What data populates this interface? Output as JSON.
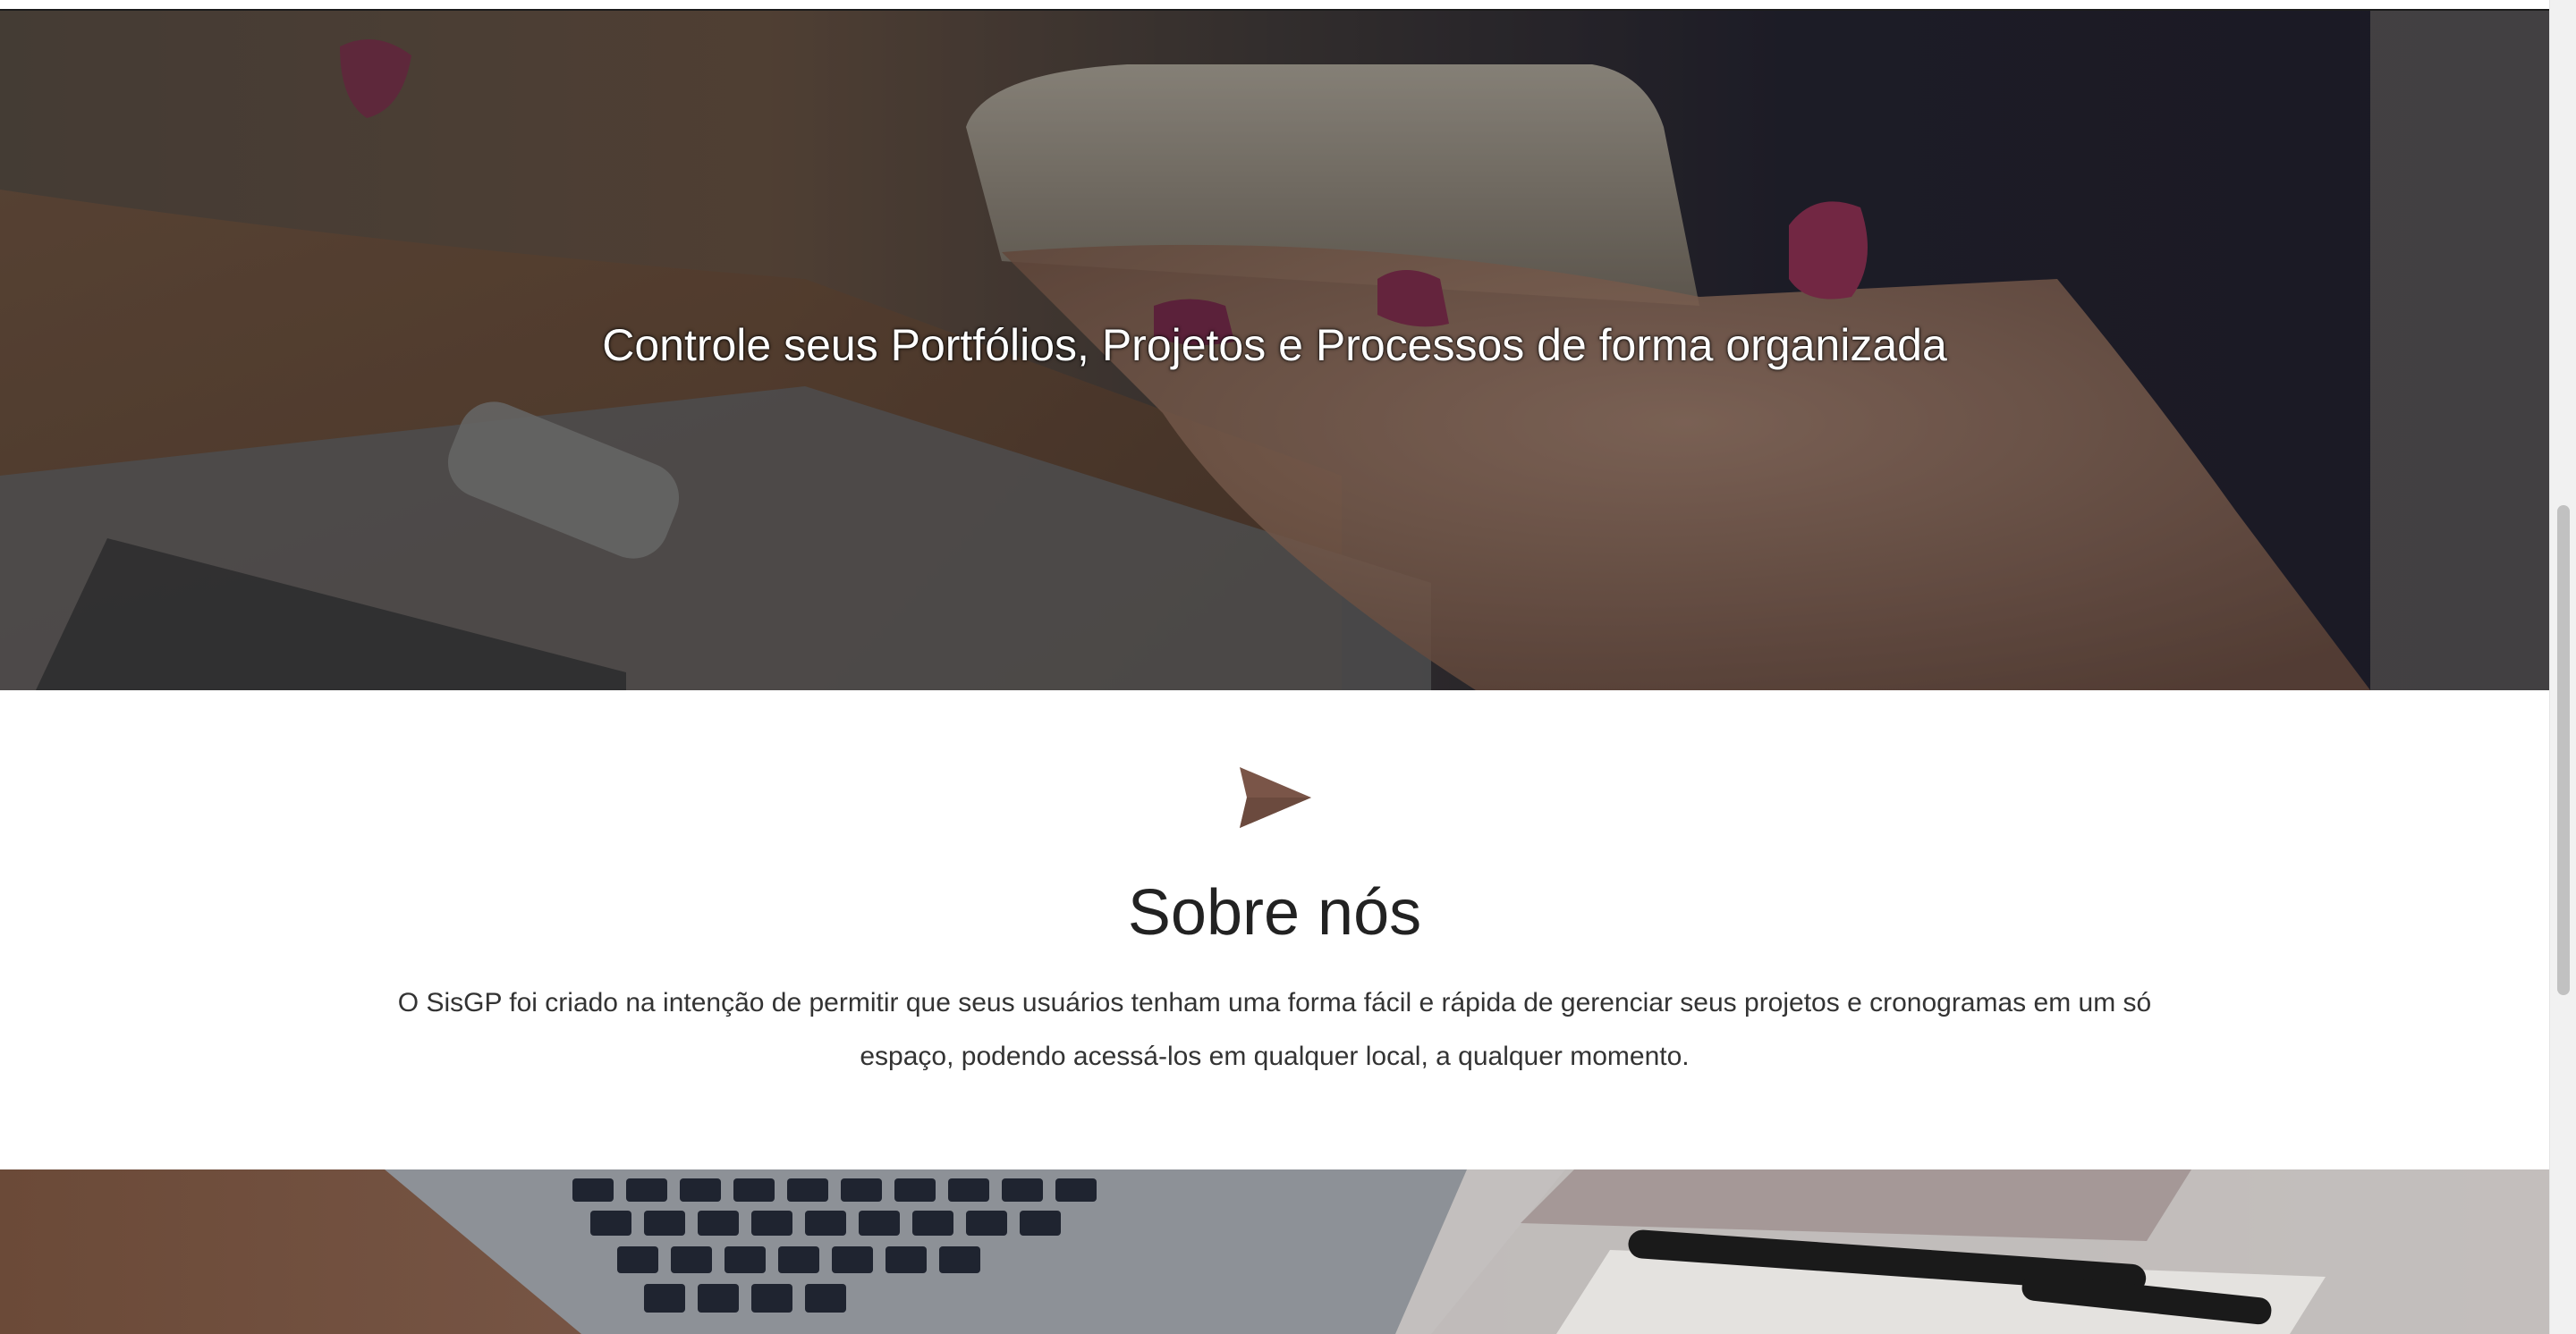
{
  "hero": {
    "title": "Controle seus Portfólios, Projetos e Processos de forma organizada"
  },
  "about": {
    "icon": "send-icon",
    "title": "Sobre nós",
    "text_line1": "O SisGP foi criado na intenção de permitir que seus usuários tenham uma forma fácil e rápida de gerenciar seus projetos e cronogramas em um só",
    "text_line2": "espaço, podendo acessá-los em qualquer local, a qualquer momento."
  },
  "colors": {
    "accent": "#7a5548",
    "hero_overlay": "#1e1612",
    "text": "#333333"
  }
}
